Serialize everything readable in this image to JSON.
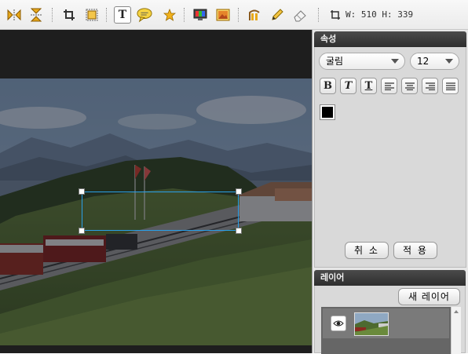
{
  "toolbar": {
    "tools": [
      {
        "icon": "flip-horizontal-icon"
      },
      {
        "icon": "flip-vertical-icon"
      },
      {
        "icon": "crop-icon"
      },
      {
        "icon": "resize-icon"
      },
      {
        "icon": "text-tool-icon"
      },
      {
        "icon": "speech-bubble-icon"
      },
      {
        "icon": "star-icon"
      },
      {
        "icon": "color-filter-icon"
      },
      {
        "icon": "image-frame-icon"
      },
      {
        "icon": "stamp-icon"
      },
      {
        "icon": "pencil-icon"
      },
      {
        "icon": "eraser-icon"
      },
      {
        "icon": "canvas-size-icon"
      }
    ],
    "dimensions_label": "W: 510 H: 339"
  },
  "properties": {
    "title": "속성",
    "font_family": "굴림",
    "font_size": "12",
    "format_buttons": [
      {
        "label": "B",
        "icon": "bold-icon"
      },
      {
        "label": "T",
        "icon": "italic-icon"
      },
      {
        "label": "T",
        "icon": "underline-icon"
      },
      {
        "icon": "align-left-icon"
      },
      {
        "icon": "align-center-icon"
      },
      {
        "icon": "align-right-icon"
      },
      {
        "icon": "align-justify-icon"
      }
    ],
    "text_color": "#000000",
    "cancel_label": "취 소",
    "apply_label": "적 용"
  },
  "layers": {
    "title": "레이어",
    "new_layer_label": "새 레이어",
    "items": [
      {
        "visible_icon": "eye-icon",
        "thumbnail": "layer-thumbnail"
      }
    ]
  },
  "colors": {
    "toolbar_bg": "#efefef",
    "canvas_bg": "#1e1e1e",
    "selection": "#2aa0e8",
    "panel_header": "#3a3a3a",
    "panel_bg": "#d9d9d9",
    "active_text_tool": "#f5d342"
  }
}
